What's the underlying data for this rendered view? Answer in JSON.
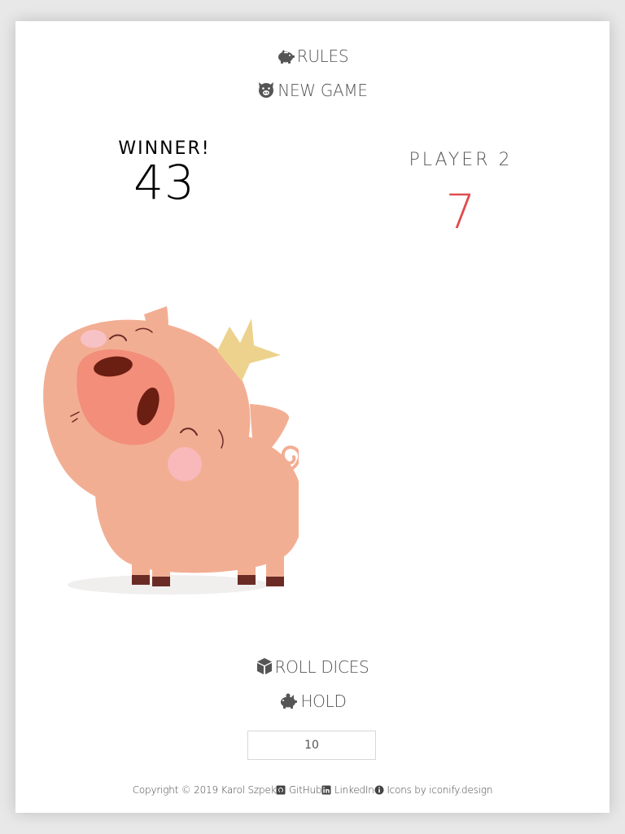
{
  "menu": {
    "rules_label": "RULES",
    "new_game_label": "NEW GAME"
  },
  "player1": {
    "title": "WINNER!",
    "score": "43",
    "status": "winner"
  },
  "player2": {
    "title": "PLAYER 2",
    "score": "7",
    "score_color": "#e04b4b"
  },
  "controls": {
    "roll_label": "ROLL DICES",
    "hold_label": "HOLD",
    "target_value": "10"
  },
  "footer": {
    "copyright": "Copyright © 2019 Karol Szpek",
    "github": "GitHub",
    "linkedin": "LinkedIn",
    "icons_credit": "Icons by iconify.design"
  },
  "icons": {
    "rules": "piggy-bank-icon",
    "new_game": "pig-face-icon",
    "roll": "dice-cube-icon",
    "hold": "piggy-bank-icon",
    "github": "github-icon",
    "linkedin": "linkedin-icon",
    "info": "info-icon"
  }
}
